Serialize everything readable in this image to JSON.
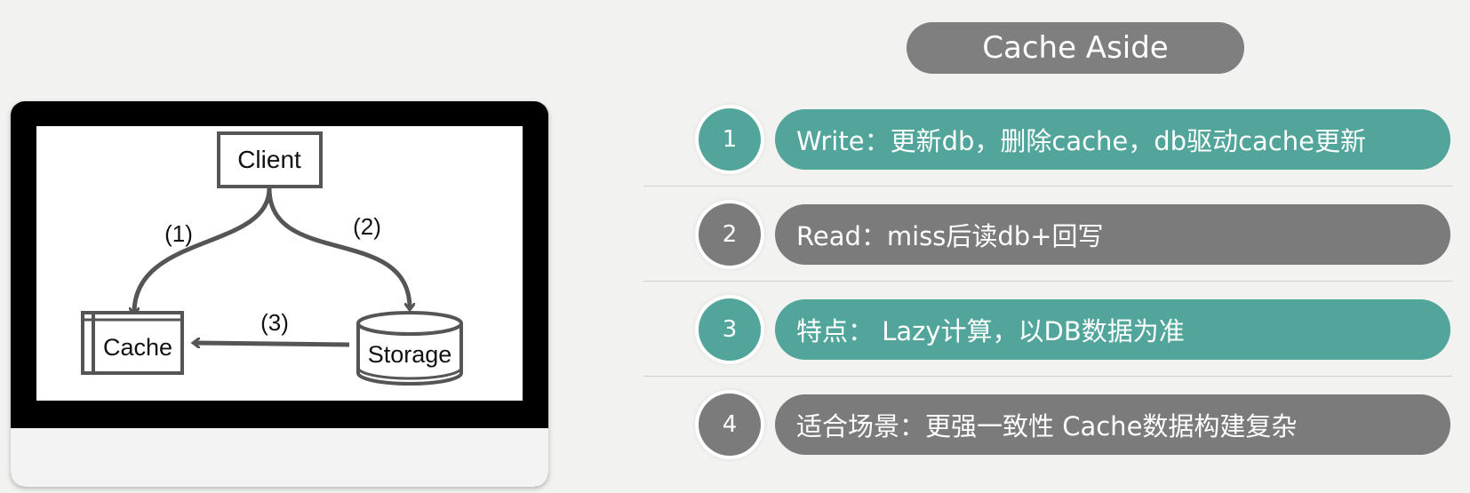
{
  "title": "Cache Aside",
  "diagram": {
    "client_label": "Client",
    "cache_label": "Cache",
    "storage_label": "Storage",
    "edge1_label": "(1)",
    "edge2_label": "(2)",
    "edge3_label": "(3)"
  },
  "items": [
    {
      "number": "1",
      "text": "Write：更新db，删除cache，db驱动cache更新",
      "color": "#52a59a"
    },
    {
      "number": "2",
      "text": "Read：miss后读db+回写",
      "color": "#7b7b7b"
    },
    {
      "number": "3",
      "text": "特点： Lazy计算，以DB数据为准",
      "color": "#52a59a"
    },
    {
      "number": "4",
      "text": "适合场景：更强一致性 Cache数据构建复杂",
      "color": "#7b7b7b"
    }
  ]
}
